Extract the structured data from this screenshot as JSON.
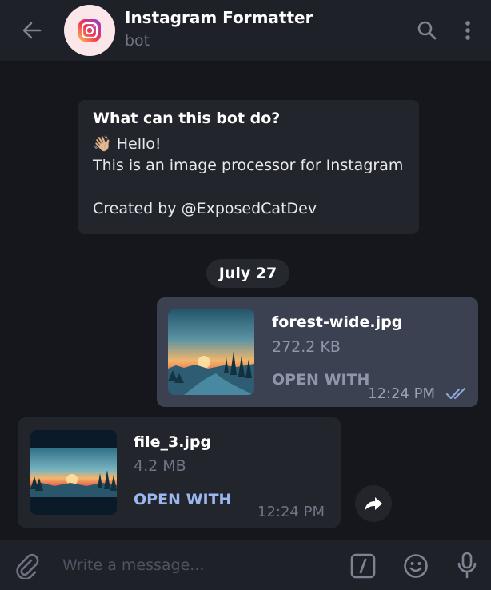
{
  "header": {
    "title": "Instagram Formatter",
    "subtitle": "bot",
    "back_icon": "arrow-left-icon",
    "search_icon": "search-icon",
    "menu_icon": "more-vertical-icon",
    "avatar_icon": "instagram-logo-icon"
  },
  "bot_info": {
    "title": "What can this bot do?",
    "greeting_emoji": "👋🏼",
    "greeting": "Hello!",
    "description": "This is an image processor for Instagram",
    "credit": "Created by @ExposedCatDev"
  },
  "date_separator": "July 27",
  "messages": [
    {
      "direction": "outgoing",
      "file_name": "forest-wide.jpg",
      "file_size": "272.2 KB",
      "action": "OPEN WITH",
      "time": "12:24 PM",
      "status_icon": "double-check-icon"
    },
    {
      "direction": "incoming",
      "file_name": "file_3.jpg",
      "file_size": "4.2 MB",
      "action": "OPEN WITH",
      "time": "12:24 PM",
      "action_icon": "forward-icon"
    }
  ],
  "input": {
    "placeholder": "Write a message...",
    "attach_icon": "paperclip-icon",
    "commands_icon": "slash-command-icon",
    "emoji_icon": "smiley-icon",
    "mic_icon": "microphone-icon"
  },
  "colors": {
    "background": "#15171c",
    "header": "#1f2128",
    "outgoing_bubble": "#3c4151",
    "incoming_bubble": "#23252c",
    "link_accent": "#9bb7f0"
  }
}
